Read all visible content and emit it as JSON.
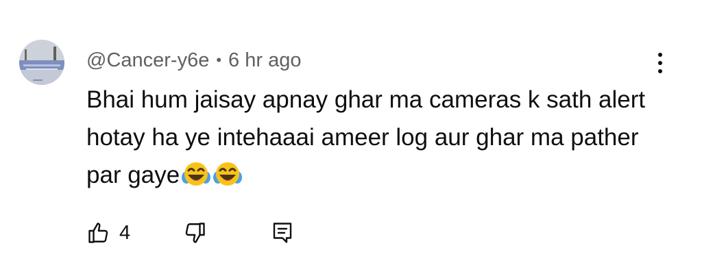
{
  "comment": {
    "author": "@Cancer-y6e",
    "separator": "•",
    "timestamp": "6 hr ago",
    "text": "Bhai hum jaisay apnay ghar ma cameras k sath alert hotay ha ye intehaaai ameer log aur ghar ma pather par gaye",
    "emojis": [
      "face-with-tears-of-joy",
      "face-with-tears-of-joy"
    ],
    "like_count": "4"
  },
  "icons": {
    "menu": "more-vertical-icon",
    "like": "thumbs-up-icon",
    "dislike": "thumbs-down-icon",
    "reply": "comment-reply-icon"
  },
  "colors": {
    "text_primary": "#0f0f0f",
    "text_secondary": "#606060",
    "emoji_face": "#f7c31b"
  }
}
